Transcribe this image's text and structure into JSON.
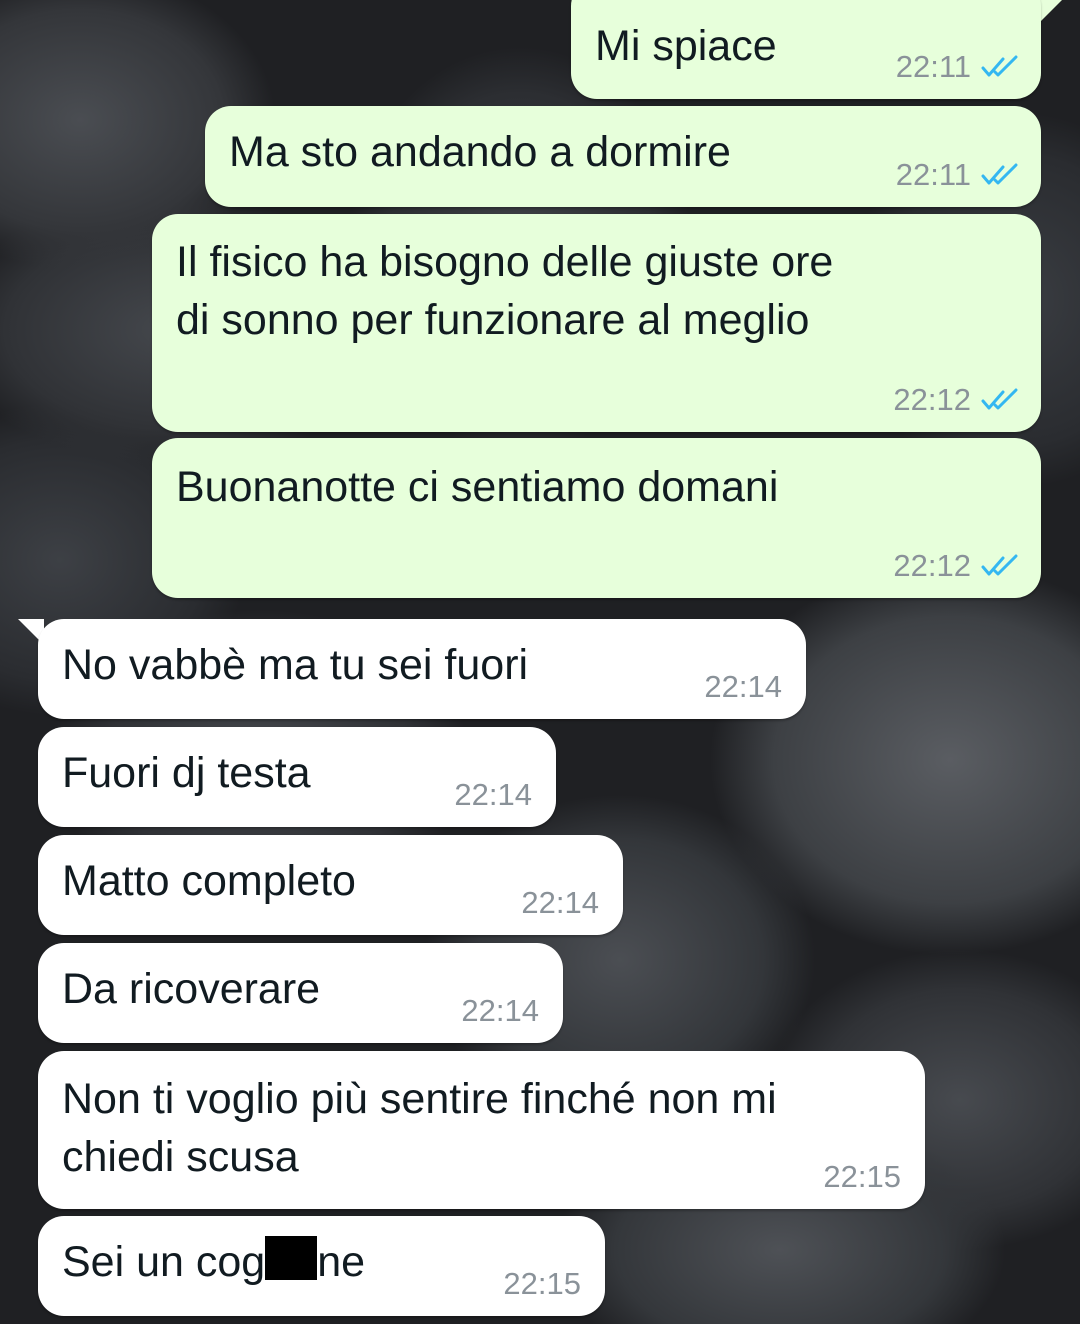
{
  "conversation": {
    "outgoing": [
      {
        "text": "Mi spiace",
        "time": "22:11",
        "status": "read"
      },
      {
        "text": "Ma sto andando a dormire",
        "time": "22:11",
        "status": "read"
      },
      {
        "text": "Il fisico ha bisogno delle giuste ore\ndi sonno per funzionare al meglio",
        "time": "22:12",
        "status": "read"
      },
      {
        "text": "Buonanotte ci sentiamo domani",
        "time": "22:12",
        "status": "read"
      }
    ],
    "incoming": [
      {
        "text": "No vabbè ma tu sei fuori",
        "time": "22:14"
      },
      {
        "text": "Fuori dj testa",
        "time": "22:14"
      },
      {
        "text": "Matto completo",
        "time": "22:14"
      },
      {
        "text": "Da ricoverare",
        "time": "22:14"
      },
      {
        "text": "Non ti voglio più sentire finché non mi\nchiedi scusa",
        "time": "22:15"
      },
      {
        "text_before": "Sei un cog",
        "text_after": "ne",
        "time": "22:15",
        "redacted": true
      }
    ]
  },
  "colors": {
    "outgoing_bubble": "#e7ffdb",
    "incoming_bubble": "#ffffff",
    "read_receipt": "#34b7f1",
    "timestamp": "#8a9299",
    "message_text": "#111b21"
  },
  "icons": {
    "read_receipt": "double-check-icon"
  }
}
